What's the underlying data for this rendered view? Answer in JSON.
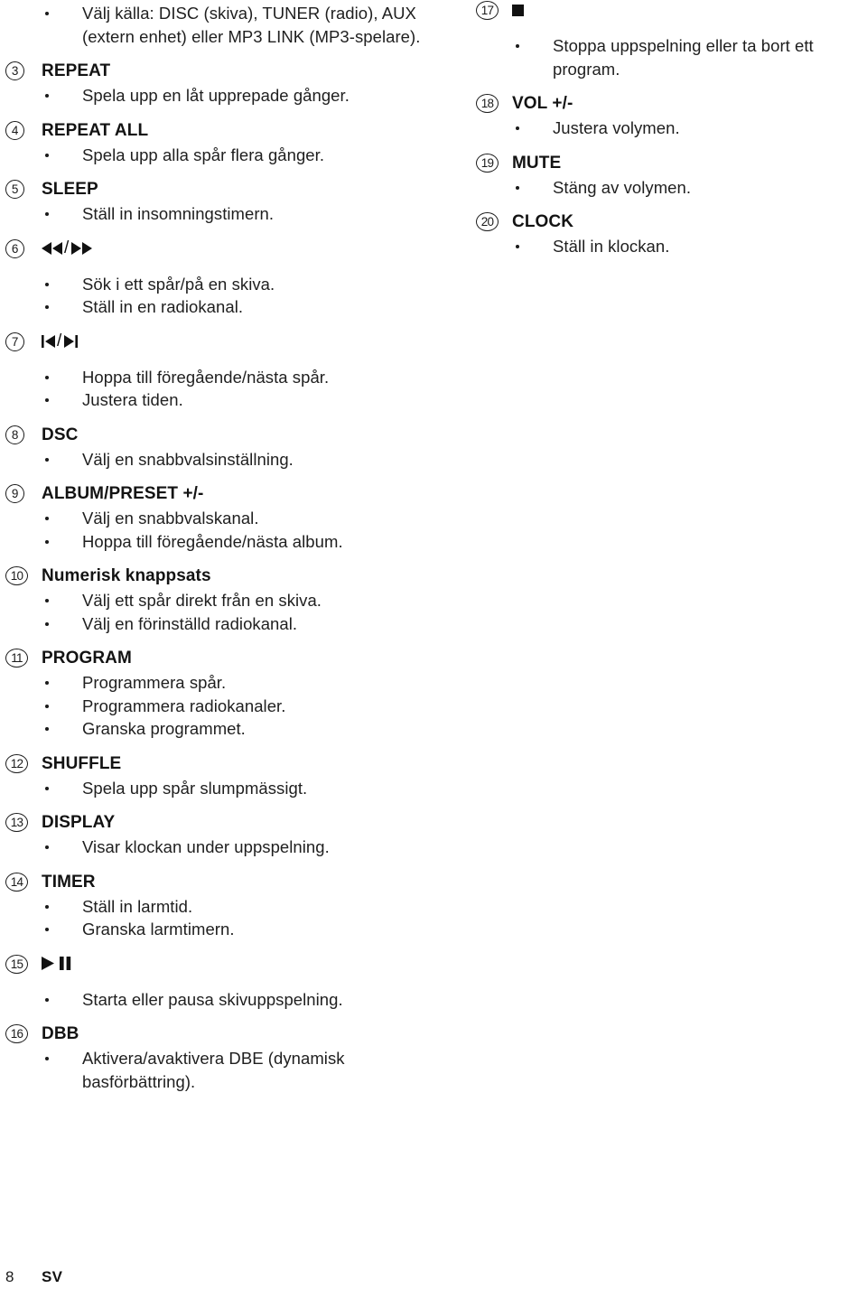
{
  "document": {
    "language_code": "SV",
    "page_number": "8"
  },
  "left_column": {
    "continuation": {
      "bullets": [
        "Välj källa: DISC (skiva), TUNER (radio), AUX (extern enhet) eller MP3 LINK (MP3-spelare)."
      ]
    },
    "entries": [
      {
        "number": "3",
        "label": "REPEAT",
        "label_type": "text",
        "bullets": [
          "Spela upp en låt upprepade gånger."
        ]
      },
      {
        "number": "4",
        "label": "REPEAT ALL",
        "label_type": "text",
        "bullets": [
          "Spela upp alla spår flera gånger."
        ]
      },
      {
        "number": "5",
        "label": "SLEEP",
        "label_type": "text",
        "bullets": [
          "Ställ in insomningstimern."
        ]
      },
      {
        "number": "6",
        "label": "◀◀/▶▶",
        "label_type": "icon",
        "icon": "rewind-fastforward-icon",
        "bullets": [
          "Sök i ett spår/på en skiva.",
          "Ställ in en radiokanal."
        ]
      },
      {
        "number": "7",
        "label": "|◀/▶|",
        "label_type": "icon",
        "icon": "previous-next-track-icon",
        "bullets": [
          "Hoppa till föregående/nästa spår.",
          "Justera tiden."
        ]
      },
      {
        "number": "8",
        "label": "DSC",
        "label_type": "text",
        "bullets": [
          "Välj en snabbvalsinställning."
        ]
      },
      {
        "number": "9",
        "label": "ALBUM/PRESET +/-",
        "label_type": "text",
        "bullets": [
          "Välj en snabbvalskanal.",
          "Hoppa till föregående/nästa album."
        ]
      },
      {
        "number": "10",
        "label": "Numerisk knappsats",
        "label_type": "text",
        "bullets": [
          "Välj ett spår direkt från en skiva.",
          "Välj en förinställd radiokanal."
        ]
      },
      {
        "number": "11",
        "label": "PROGRAM",
        "label_type": "text",
        "bullets": [
          "Programmera spår.",
          "Programmera radiokanaler.",
          "Granska programmet."
        ]
      },
      {
        "number": "12",
        "label": "SHUFFLE",
        "label_type": "text",
        "bullets": [
          "Spela upp spår slumpmässigt."
        ]
      },
      {
        "number": "13",
        "label": "DISPLAY",
        "label_type": "text",
        "bullets": [
          "Visar klockan under uppspelning."
        ]
      },
      {
        "number": "14",
        "label": "TIMER",
        "label_type": "text",
        "bullets": [
          "Ställ in larmtid.",
          "Granska larmtimern."
        ]
      },
      {
        "number": "15",
        "label": "▶❙❙",
        "label_type": "icon",
        "icon": "play-pause-icon",
        "bullets": [
          "Starta eller pausa skivuppspelning."
        ]
      },
      {
        "number": "16",
        "label": "DBB",
        "label_type": "text",
        "bullets": [
          "Aktivera/avaktivera DBE (dynamisk basförbättring)."
        ]
      }
    ]
  },
  "right_column": {
    "entries": [
      {
        "number": "17",
        "label": "■",
        "label_type": "icon",
        "icon": "stop-icon",
        "bullets": [
          "Stoppa uppspelning eller ta bort ett program."
        ]
      },
      {
        "number": "18",
        "label": "VOL +/-",
        "label_type": "text",
        "bullets": [
          "Justera volymen."
        ]
      },
      {
        "number": "19",
        "label": "MUTE",
        "label_type": "text",
        "bullets": [
          "Stäng av volymen."
        ]
      },
      {
        "number": "20",
        "label": "CLOCK",
        "label_type": "text",
        "bullets": [
          "Ställ in klockan."
        ]
      }
    ]
  }
}
